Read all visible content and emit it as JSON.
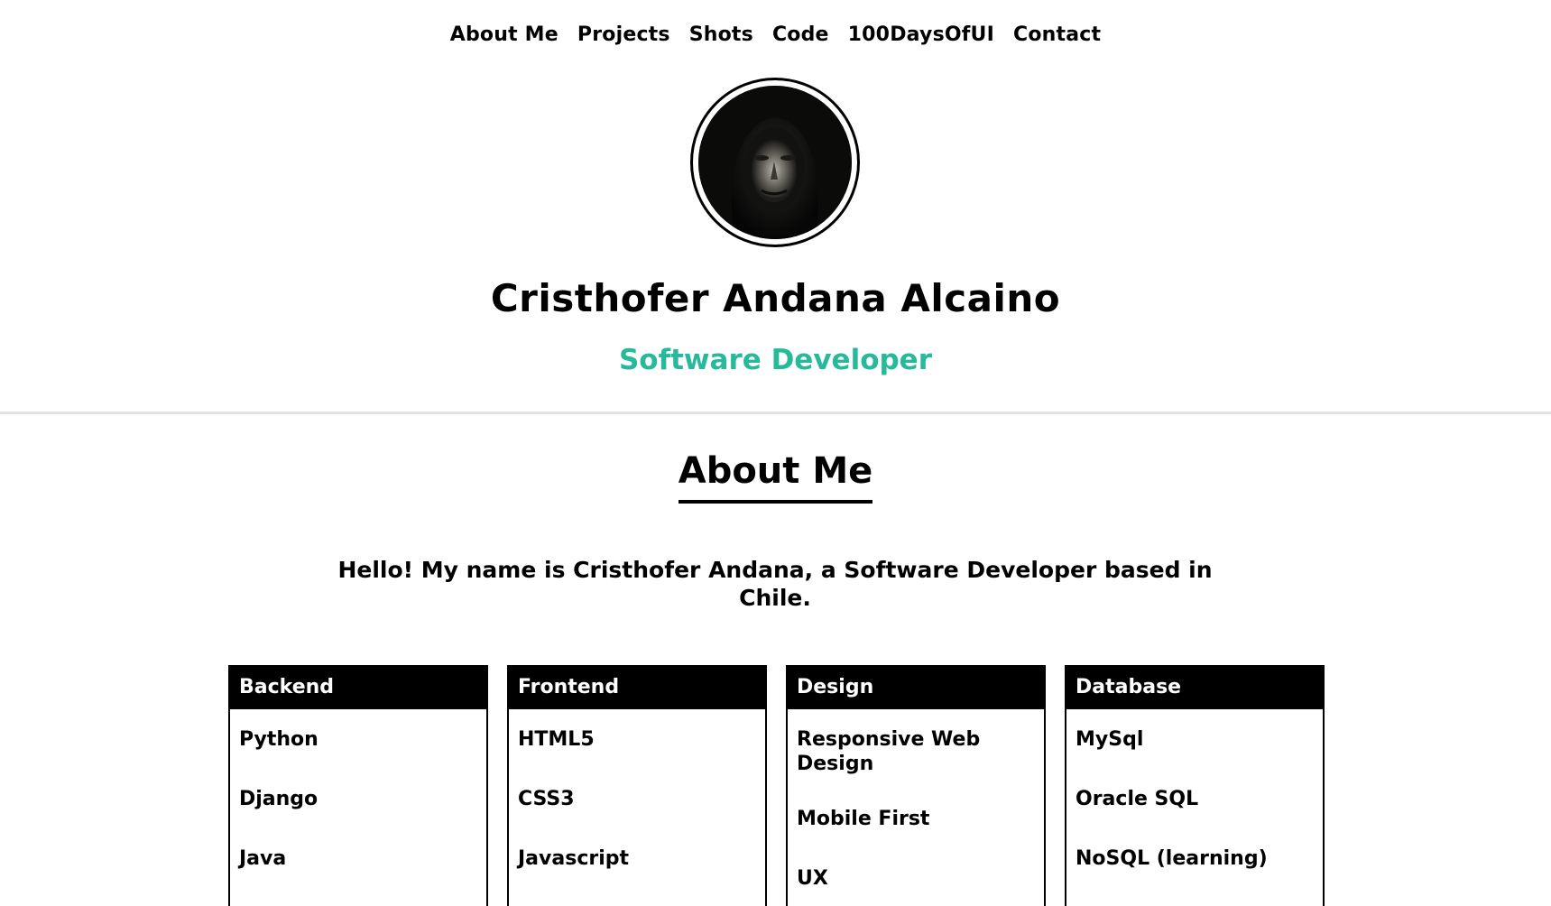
{
  "nav": {
    "items": [
      {
        "label": "About Me"
      },
      {
        "label": "Projects"
      },
      {
        "label": "Shots"
      },
      {
        "label": "Code"
      },
      {
        "label": "100DaysOfUI"
      },
      {
        "label": "Contact"
      }
    ]
  },
  "hero": {
    "name": "Cristhofer Andana Alcaino",
    "role": "Software Developer"
  },
  "about": {
    "title": "About Me",
    "intro": "Hello! My name is Cristhofer Andana, a Software Developer based in Chile."
  },
  "skills": [
    {
      "title": "Backend",
      "items": [
        "Python",
        "Django",
        "Java"
      ]
    },
    {
      "title": "Frontend",
      "items": [
        "HTML5",
        "CSS3",
        "Javascript"
      ]
    },
    {
      "title": "Design",
      "items": [
        "Responsive Web Design",
        "Mobile First",
        "UX"
      ]
    },
    {
      "title": "Database",
      "items": [
        "MySql",
        "Oracle SQL",
        "NoSQL (learning)"
      ]
    }
  ],
  "colors": {
    "accent": "#26b99a",
    "text": "#000000",
    "divider": "#e3e3e3"
  }
}
